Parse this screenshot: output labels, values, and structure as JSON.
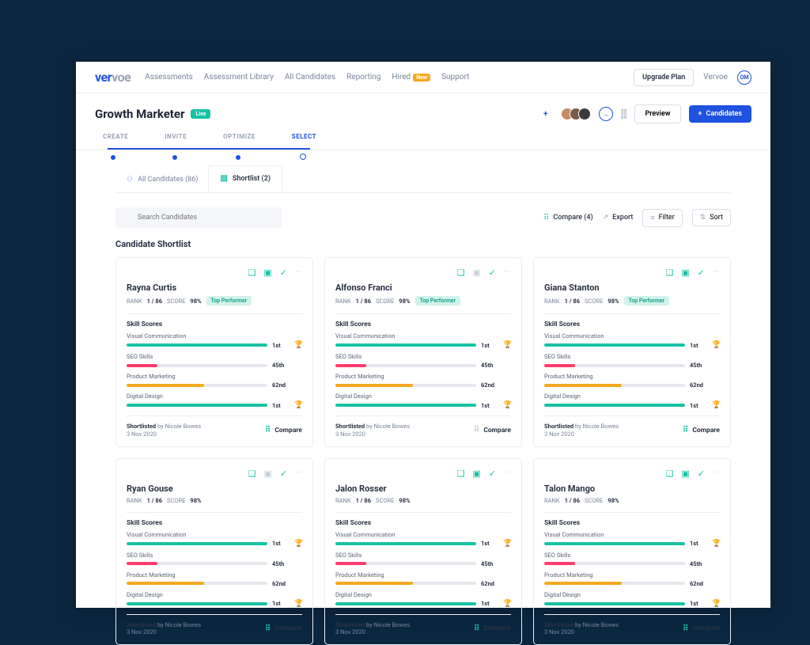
{
  "nav": {
    "brand_a": "ver",
    "brand_b": "voe",
    "links": [
      "Assessments",
      "Assessment Library",
      "All Candidates",
      "Reporting",
      "Hired",
      "Support"
    ],
    "new_badge": "New",
    "upgrade": "Upgrade Plan",
    "account": "Vervoe",
    "avatar": "OM"
  },
  "sub": {
    "title": "Growth Marketer",
    "live": "Live",
    "preview": "Preview",
    "candidates_btn": "Candidates"
  },
  "stepper": [
    "CREATE",
    "INVITE",
    "OPTIMIZE",
    "SELECT"
  ],
  "stepper_active": 3,
  "tabs": {
    "all": "All Candidates (86)",
    "shortlist": "Shortlist (2)"
  },
  "toolbar": {
    "placeholder": "Search Candidates",
    "compare": "Compare (4)",
    "export": "Export",
    "filter": "Filter",
    "sort": "Sort"
  },
  "section_title": "Candidate Shortlist",
  "labels": {
    "rank": "RANK",
    "score": "SCORE",
    "top_perf": "Top Performer",
    "skills": "Skill Scores",
    "shortlisted": "Shortlisted",
    "by": "by",
    "compare": "Compare"
  },
  "skills_meta": [
    {
      "name": "Visual Communication",
      "color": "#17c2a4",
      "pct": 100,
      "rank": "1st",
      "trophy": true
    },
    {
      "name": "SEO Skills",
      "color": "#ff3b6b",
      "pct": 22,
      "rank": "45th",
      "trophy": false
    },
    {
      "name": "Product Marketing",
      "color": "#f6a821",
      "pct": 55,
      "rank": "62nd",
      "trophy": false
    },
    {
      "name": "Digital Design",
      "color": "#17c2a4",
      "pct": 100,
      "rank": "1st",
      "trophy": true
    }
  ],
  "candidates": [
    {
      "name": "Rayna Curtis",
      "rank": "1 / 86",
      "score": "98%",
      "top": true,
      "by": "Nicole Bowes",
      "date": "3 Nov 2020",
      "chat_muted": false,
      "cmp_active": true
    },
    {
      "name": "Alfonso Franci",
      "rank": "1 / 86",
      "score": "98%",
      "top": true,
      "by": "Nicole Bowes",
      "date": "3 Nov 2020",
      "chat_muted": true,
      "cmp_active": false
    },
    {
      "name": "Giana Stanton",
      "rank": "1 / 86",
      "score": "98%",
      "top": true,
      "by": "Nicole Bowes",
      "date": "3 Nov 2020",
      "chat_muted": false,
      "cmp_active": true
    },
    {
      "name": "Ryan Gouse",
      "rank": "1 / 86",
      "score": "98%",
      "top": false,
      "by": "Nicole Bowes",
      "date": "3 Nov 2020",
      "chat_muted": true,
      "cmp_active": true
    },
    {
      "name": "Jalon Rosser",
      "rank": "1 / 86",
      "score": "98%",
      "top": false,
      "by": "Nicole Bowes",
      "date": "3 Nov 2020",
      "chat_muted": false,
      "cmp_active": true
    },
    {
      "name": "Talon Mango",
      "rank": "1 / 86",
      "score": "98%",
      "top": false,
      "by": "Nicole Bowes",
      "date": "3 Nov 2020",
      "chat_muted": false,
      "cmp_active": true
    }
  ]
}
